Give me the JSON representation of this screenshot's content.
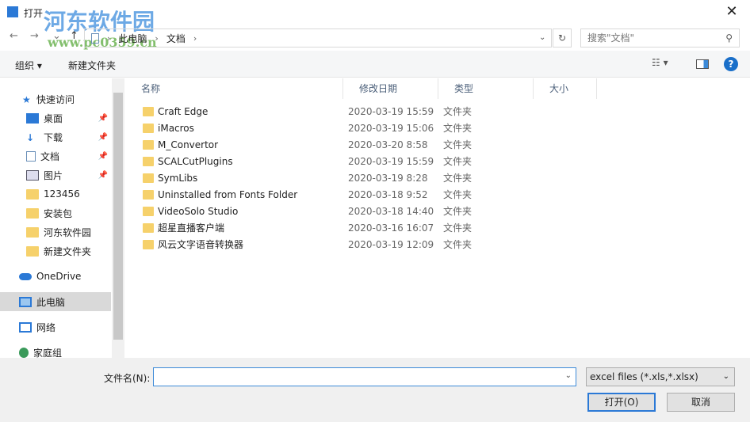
{
  "window": {
    "title": "打开",
    "close": "✕"
  },
  "watermark": {
    "name": "河东软件园",
    "url": "www.pc0359.cn"
  },
  "nav": {
    "back": "←",
    "forward": "→",
    "recent": "⌄",
    "up": "↑",
    "path": [
      "此电脑",
      "文档"
    ],
    "sep": "›",
    "dropdown": "⌄",
    "refresh": "↻",
    "search_placeholder": "搜索\"文档\"",
    "search_icon": "⚲"
  },
  "toolbar": {
    "organize": "组织 ▾",
    "new_folder": "新建文件夹",
    "view": "☷ ▾",
    "help": "?"
  },
  "sidebar": {
    "items": [
      {
        "label": "快速访问",
        "icon": "star-icon"
      },
      {
        "label": "桌面",
        "icon": "desktop-icon",
        "pinned": true
      },
      {
        "label": "下载",
        "icon": "download-icon",
        "pinned": true
      },
      {
        "label": "文档",
        "icon": "document-icon",
        "pinned": true
      },
      {
        "label": "图片",
        "icon": "picture-icon",
        "pinned": true
      },
      {
        "label": "123456",
        "icon": "folder-icon"
      },
      {
        "label": "安装包",
        "icon": "folder-icon"
      },
      {
        "label": "河东软件园",
        "icon": "folder-icon"
      },
      {
        "label": "新建文件夹",
        "icon": "folder-icon"
      },
      {
        "label": "OneDrive",
        "icon": "cloud-icon"
      },
      {
        "label": "此电脑",
        "icon": "computer-icon",
        "selected": true
      },
      {
        "label": "网络",
        "icon": "network-icon"
      },
      {
        "label": "家庭组",
        "icon": "homegroup-icon"
      }
    ],
    "pin": "📌"
  },
  "columns": [
    "名称",
    "修改日期",
    "类型",
    "大小"
  ],
  "files": [
    {
      "name": "Craft Edge",
      "date": "2020-03-19 15:59",
      "type": "文件夹"
    },
    {
      "name": "iMacros",
      "date": "2020-03-19 15:06",
      "type": "文件夹"
    },
    {
      "name": "M_Convertor",
      "date": "2020-03-20 8:58",
      "type": "文件夹"
    },
    {
      "name": "SCALCutPlugins",
      "date": "2020-03-19 15:59",
      "type": "文件夹"
    },
    {
      "name": "SymLibs",
      "date": "2020-03-19 8:28",
      "type": "文件夹"
    },
    {
      "name": "Uninstalled from Fonts Folder",
      "date": "2020-03-18 9:52",
      "type": "文件夹"
    },
    {
      "name": "VideoSolo Studio",
      "date": "2020-03-18 14:40",
      "type": "文件夹"
    },
    {
      "name": "超星直播客户端",
      "date": "2020-03-16 16:07",
      "type": "文件夹"
    },
    {
      "name": "风云文字语音转换器",
      "date": "2020-03-19 12:09",
      "type": "文件夹"
    }
  ],
  "bottom": {
    "filename_label": "文件名(N):",
    "filename_value": "",
    "filter": "excel files (*.xls,*.xlsx)",
    "open": "打开(O)",
    "cancel": "取消",
    "dd": "⌄"
  }
}
